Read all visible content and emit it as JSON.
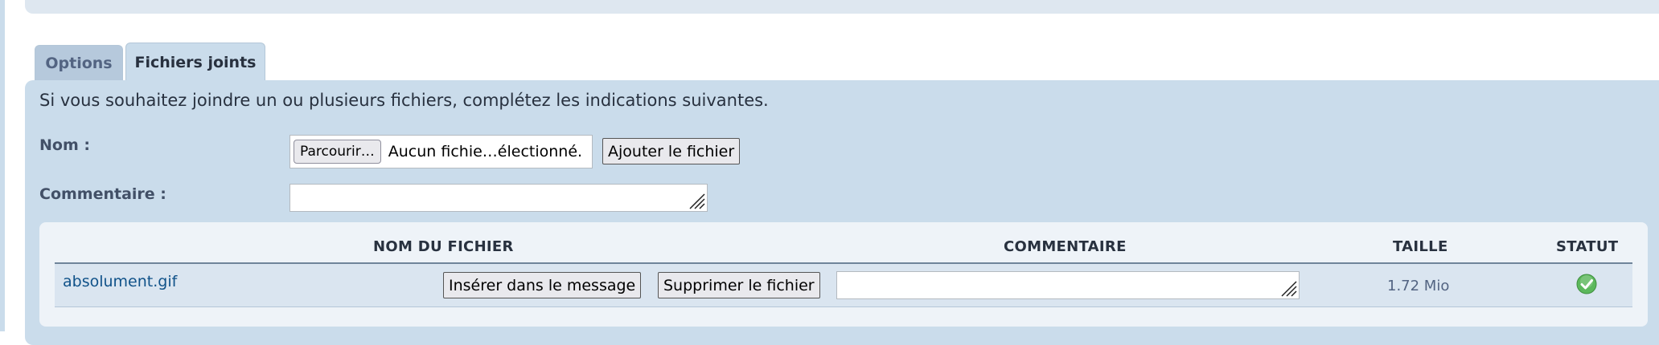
{
  "tabs": [
    {
      "label": "Options"
    },
    {
      "label": "Fichiers joints"
    }
  ],
  "attachments": {
    "intro": "Si vous souhaitez joindre un ou plusieurs fichiers, complétez les indications suivantes.",
    "name_label": "Nom :",
    "browse_button": "Parcourir…",
    "no_file_selected": "Aucun fichie…électionné.",
    "add_file_button": "Ajouter le fichier",
    "comment_label": "Commentaire :",
    "comment_value": ""
  },
  "table": {
    "headers": {
      "filename": "NOM DU FICHIER",
      "comment": "COMMENTAIRE",
      "size": "TAILLE",
      "status": "STATUT"
    },
    "rows": [
      {
        "filename": "absolument.gif",
        "insert_button": "Insérer dans le message",
        "delete_button": "Supprimer le fichier",
        "comment": "",
        "size": "1.72 Mio",
        "status_icon": "check-circle-icon",
        "status_color": "#5cb85c"
      }
    ]
  },
  "colors": {
    "panel_bg": "#cadceb",
    "link": "#105289"
  }
}
